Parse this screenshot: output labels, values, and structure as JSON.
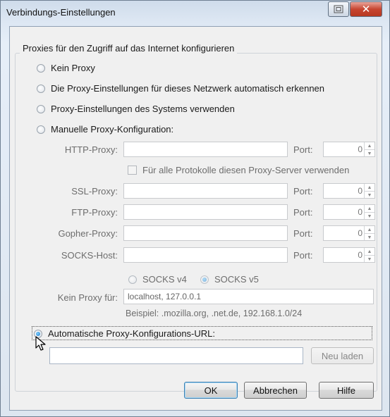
{
  "window": {
    "title": "Verbindungs-Einstellungen"
  },
  "group": {
    "legend": "Proxies für den Zugriff auf das Internet konfigurieren"
  },
  "options": {
    "no_proxy": "Kein Proxy",
    "auto_detect": "Die Proxy-Einstellungen für dieses Netzwerk automatisch erkennen",
    "system": "Proxy-Einstellungen des Systems verwenden",
    "manual": "Manuelle Proxy-Konfiguration:",
    "auto_url": "Automatische Proxy-Konfigurations-URL:"
  },
  "manual": {
    "http_label": "HTTP-Proxy:",
    "ssl_label": "SSL-Proxy:",
    "ftp_label": "FTP-Proxy:",
    "gopher_label": "Gopher-Proxy:",
    "socks_label": "SOCKS-Host:",
    "port_label": "Port:",
    "http_port": "0",
    "ssl_port": "0",
    "ftp_port": "0",
    "gopher_port": "0",
    "socks_port": "0",
    "share_label": "Für alle Protokolle diesen Proxy-Server verwenden",
    "socks_v4": "SOCKS v4",
    "socks_v5": "SOCKS v5",
    "no_proxy_for_label": "Kein Proxy für:",
    "no_proxy_for_value": "localhost, 127.0.0.1",
    "example": "Beispiel: .mozilla.org, .net.de, 192.168.1.0/24"
  },
  "auto": {
    "url_value": "",
    "reload_label": "Neu laden"
  },
  "buttons": {
    "ok": "OK",
    "cancel": "Abbrechen",
    "help": "Hilfe"
  },
  "icons": {
    "close": "close-icon",
    "help": "help-icon",
    "cursor": "mouse-pointer-icon"
  },
  "colors": {
    "selected_radio": "#1877c9",
    "dialog_border": "#6f7f92"
  }
}
